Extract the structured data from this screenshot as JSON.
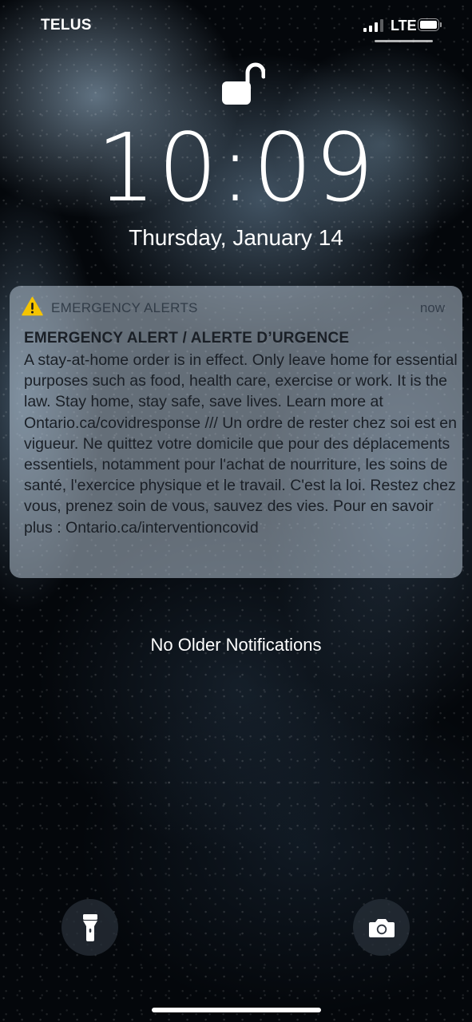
{
  "status_bar": {
    "carrier": "TELUS",
    "network": "LTE",
    "signal_bars": 3,
    "signal_bars_total": 4,
    "battery_level": 0.9
  },
  "lock_screen": {
    "lock_state_icon": "unlocked-padlock-icon",
    "time": "10:09",
    "date": "Thursday, January 14"
  },
  "notification": {
    "icon": "warning-triangle-icon",
    "icon_color": "#f5c400",
    "app_name": "EMERGENCY ALERTS",
    "timestamp": "now",
    "title": "EMERGENCY ALERT / ALERTE D’URGENCE",
    "body": "A stay-at-home order is in effect. Only leave home for essential purposes such as food, health care, exercise or work. It is the law. Stay home, stay safe, save lives. Learn more at Ontario.ca/covidresponse /// Un ordre de rester chez soi est en vigueur. Ne quittez votre domicile que pour des déplacements essentiels, notamment pour l'achat de nourriture, les soins de santé, l'exercice physique et le travail. C'est la loi. Restez chez vous, prenez soin de vous, sauvez des vies. Pour en savoir plus : Ontario.ca/interventioncovid"
  },
  "footer_message": "No Older Notifications",
  "quick_actions": {
    "left_icon": "flashlight-icon",
    "right_icon": "camera-icon"
  }
}
